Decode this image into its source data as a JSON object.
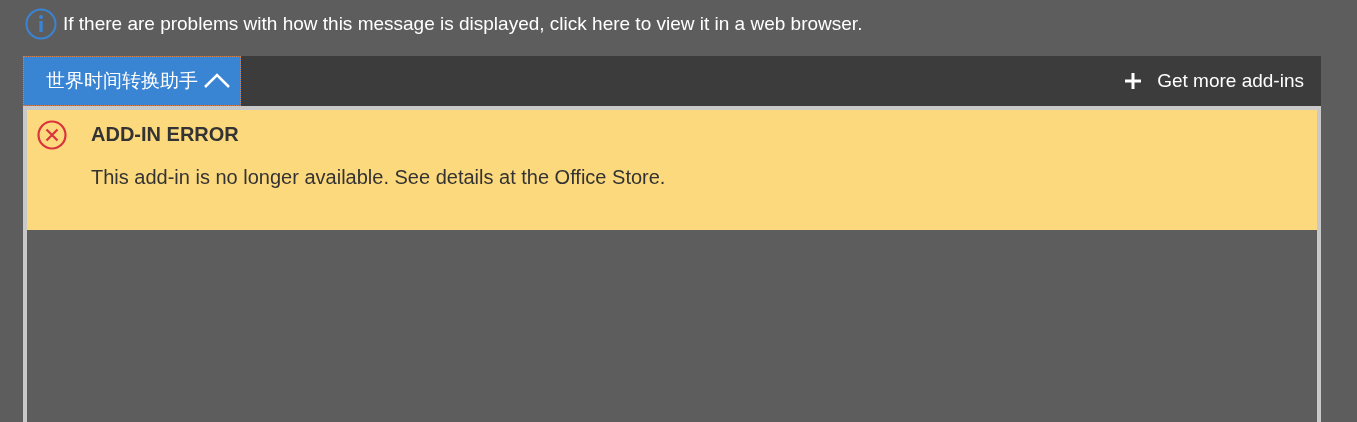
{
  "info_bar": {
    "message": "If there are problems with how this message is displayed, click here to view it in a web browser."
  },
  "addin_bar": {
    "tabs": [
      {
        "label": "世界时间转换助手",
        "selected": true,
        "expanded": true
      }
    ],
    "get_more": "Get more add-ins"
  },
  "error": {
    "title": "ADD-IN ERROR",
    "message": "This add-in is no longer available. See details at the Office Store."
  }
}
